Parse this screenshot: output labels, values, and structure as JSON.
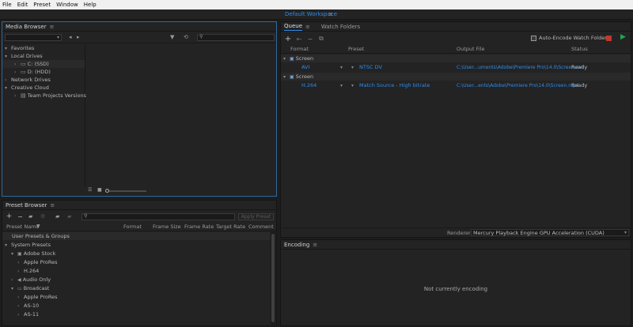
{
  "menu": [
    "File",
    "Edit",
    "Preset",
    "Window",
    "Help"
  ],
  "workspace": {
    "label": "Default Workspace"
  },
  "media_browser": {
    "title": "Media Browser",
    "tree": [
      {
        "label": "Favorites",
        "level": 0
      },
      {
        "label": "Local Drives",
        "level": 0
      },
      {
        "label": "C: (SSD)",
        "level": 1
      },
      {
        "label": "D: (HDD)",
        "level": 1
      },
      {
        "label": "Network Drives",
        "level": 0
      },
      {
        "label": "Creative Cloud",
        "level": 0
      },
      {
        "label": "Team Projects Versions",
        "level": 1
      }
    ]
  },
  "preset_browser": {
    "title": "Preset Browser",
    "apply_label": "Apply Preset",
    "columns": [
      "Preset Name",
      "Format",
      "Frame Size",
      "Frame Rate",
      "Target Rate",
      "Comment"
    ],
    "rows": [
      {
        "label": "User Presets & Groups",
        "level": 0,
        "tri": ""
      },
      {
        "label": "System Presets",
        "level": 0,
        "tri": "▾"
      },
      {
        "label": "Adobe Stock",
        "level": 1,
        "tri": "▾"
      },
      {
        "label": "Apple ProRes",
        "level": 2,
        "tri": "›"
      },
      {
        "label": "H.264",
        "level": 2,
        "tri": "›"
      },
      {
        "label": "Audio Only",
        "level": 1,
        "tri": "›"
      },
      {
        "label": "Broadcast",
        "level": 1,
        "tri": "▾"
      },
      {
        "label": "Apple ProRes",
        "level": 2,
        "tri": "›"
      },
      {
        "label": "AS-10",
        "level": 2,
        "tri": "›"
      },
      {
        "label": "AS-11",
        "level": 2,
        "tri": "›"
      }
    ]
  },
  "queue": {
    "tabs": [
      "Queue",
      "Watch Folders"
    ],
    "auto_encode_label": "Auto-Encode Watch Folders",
    "columns": [
      "Format",
      "Preset",
      "Output File",
      "Status"
    ],
    "groups": [
      {
        "name": "Screen",
        "item": {
          "format": "AVI",
          "preset": "NTSC DV",
          "output": "C:\\User...uments\\Adobe\\Premiere Pro\\14.0\\Screen.avi",
          "status": "Ready"
        }
      },
      {
        "name": "Screen",
        "item": {
          "format": "H.264",
          "preset": "Match Source - High bitrate",
          "output": "C:\\User...ents\\Adobe\\Premiere Pro\\14.0\\Screen.mp4",
          "status": "Ready"
        }
      }
    ]
  },
  "renderer": {
    "label": "Renderer:",
    "value": "Mercury Playback Engine GPU Acceleration (CUDA)"
  },
  "encoding": {
    "title": "Encoding",
    "empty": "Not currently encoding"
  },
  "colors": {
    "accent": "#2d8ceb",
    "start": "#1fa64a",
    "stop": "#c0392b"
  }
}
